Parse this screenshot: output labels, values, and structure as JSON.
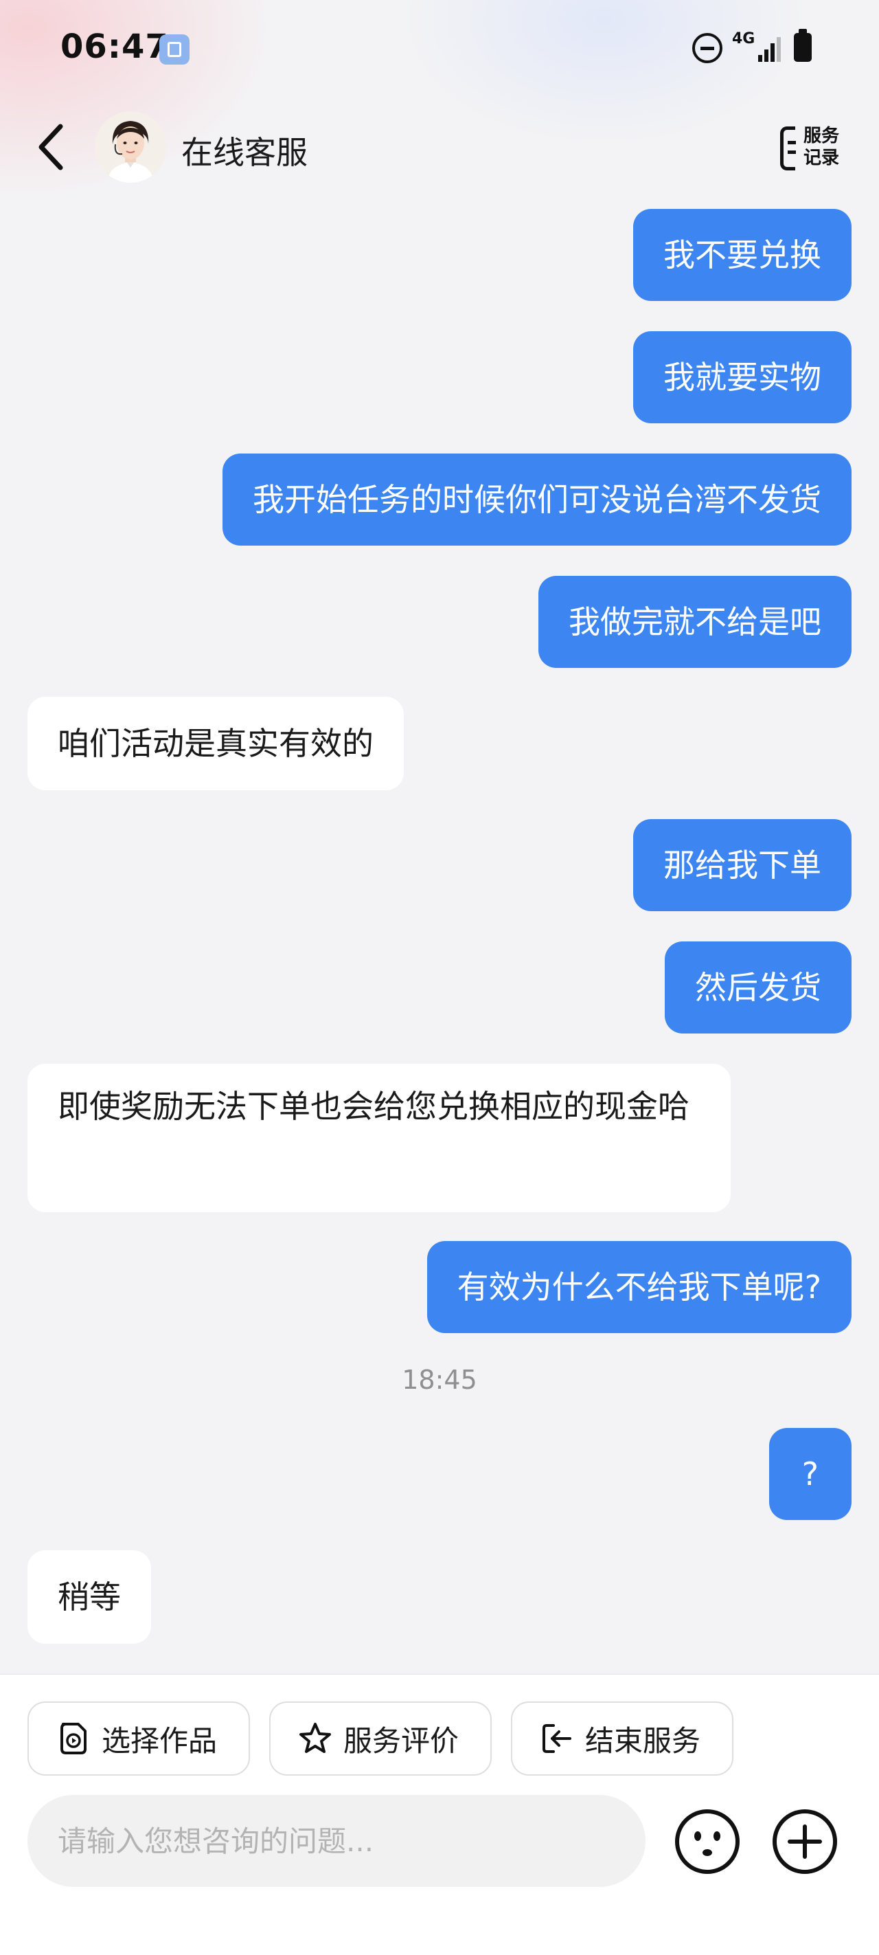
{
  "status_bar": {
    "time": "06:47",
    "network": "4G",
    "icons": [
      "app-notification-icon",
      "do-not-disturb-icon",
      "signal-icon",
      "battery-icon"
    ]
  },
  "header": {
    "title": "在线客服",
    "records_label": "服务记录",
    "records_line1": "服务",
    "records_line2": "记录",
    "icons": [
      "back-icon",
      "agent-avatar",
      "service-records-icon"
    ]
  },
  "messages": [
    {
      "from": "me",
      "text": "我不要兑换"
    },
    {
      "from": "me",
      "text": "我就要实物"
    },
    {
      "from": "me",
      "text": "我开始任务的时候你们可没说台湾不发货"
    },
    {
      "from": "me",
      "text": "我做完就不给是吧"
    },
    {
      "from": "agent",
      "text": "咱们活动是真实有效的"
    },
    {
      "from": "me",
      "text": "那给我下单"
    },
    {
      "from": "me",
      "text": "然后发货"
    },
    {
      "from": "agent",
      "text": "即使奖励无法下单也会给您兑换相应的现金哈"
    },
    {
      "from": "me",
      "text": "有效为什么不给我下单呢?"
    },
    {
      "from": "me",
      "text": "?"
    },
    {
      "from": "agent",
      "text": "稍等"
    }
  ],
  "timestamp": "18:45",
  "quick_actions": [
    {
      "label": "选择作品",
      "icon": "select-work-icon"
    },
    {
      "label": "服务评价",
      "icon": "star-icon"
    },
    {
      "label": "结束服务",
      "icon": "exit-icon"
    }
  ],
  "input": {
    "placeholder": "请输入您想咨询的问题...",
    "value": ""
  },
  "colors": {
    "my_bubble": "#3d86f1",
    "agent_bubble": "#ffffff",
    "background": "#f3f3f5"
  }
}
